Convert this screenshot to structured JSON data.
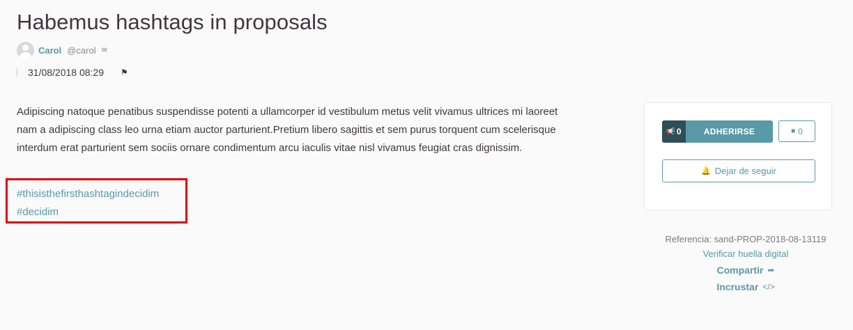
{
  "proposal": {
    "title": "Habemus hashtags in proposals",
    "author": {
      "name": "Carol",
      "nickname": "@carol"
    },
    "date": "31/08/2018 08:29",
    "body": "Adipiscing natoque penatibus suspendisse potenti a ullamcorper id vestibulum metus velit vivamus ultrices mi laoreet nam a adipiscing class leo urna etiam auctor parturient.Pretium libero sagittis et sem purus torquent cum scelerisque interdum erat parturient sem sociis ornare condimentum arcu iaculis vitae nisl vivamus feugiat cras dignissim.",
    "hashtags": [
      "#thisisthefirsthashtagindecidim",
      "#decidim"
    ]
  },
  "actions": {
    "support_count": "0",
    "support_label": "ADHERIRSE",
    "comments_count": "0",
    "follow_label": "Dejar de seguir"
  },
  "side": {
    "reference": "Referencia: sand-PROP-2018-08-13119",
    "fingerprint": "Verificar huella digital",
    "share": "Compartir",
    "embed": "Incrustar"
  },
  "icons": {
    "mail": "mail-icon",
    "flag": "flag-icon",
    "megaphone": "megaphone-icon",
    "comment": "comment-icon",
    "bell": "bell-icon",
    "share": "share-arrow-icon",
    "embed": "code-icon"
  },
  "colors": {
    "accent": "#599aa6",
    "accent_dark": "#2f4f57",
    "highlight": "#e00000",
    "text": "#3d393c"
  }
}
